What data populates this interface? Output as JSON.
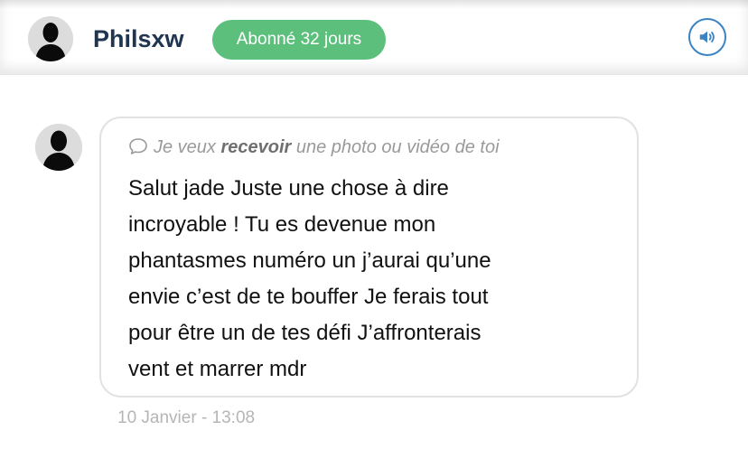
{
  "header": {
    "username": "Philsxw",
    "subscription_badge": "Abonné 32 jours",
    "sound_icon": "speaker-icon"
  },
  "message": {
    "request": {
      "icon": "chat-bubble-icon",
      "prefix": "Je veux ",
      "emphasis": "recevoir",
      "suffix": " une photo ou vidéo de toi"
    },
    "lines": [
      "Salut jade Juste une chose à dire",
      "incroyable ! Tu es devenue mon",
      "phantasmes numéro un j’aurai qu’une",
      "envie c’est de te bouffer Je ferais tout",
      "pour être un de tes défi J’affronterais",
      "vent et marrer mdr"
    ],
    "timestamp": "10 Janvier - 13:08"
  },
  "colors": {
    "badge": "#5cc07c",
    "username": "#1f3550",
    "sound_button": "#3a84c4"
  }
}
